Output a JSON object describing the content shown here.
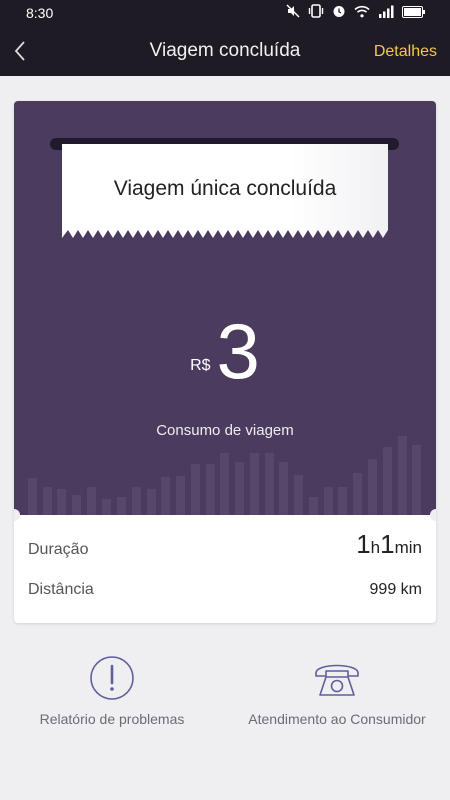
{
  "status_bar": {
    "time": "8:30"
  },
  "nav": {
    "title": "Viagem concluída",
    "details_label": "Detalhes"
  },
  "receipt": {
    "ticket_text": "Viagem única concluída",
    "currency": "R$",
    "amount": "3",
    "consumption_label": "Consumo de viagem"
  },
  "summary": {
    "duration_label": "Duração",
    "duration_hours": "1",
    "duration_h_unit": "h",
    "duration_minutes": "1",
    "duration_min_unit": "min",
    "distance_label": "Distância",
    "distance_value": "999 km"
  },
  "actions": {
    "problem_report": "Relatório de problemas",
    "customer_service": "Atendimento ao Consumidor"
  },
  "colors": {
    "header_bg": "#1f1b24",
    "accent": "#f2c94c",
    "card_purple": "#4a3b5f",
    "icon_color": "#5f5f9b"
  }
}
